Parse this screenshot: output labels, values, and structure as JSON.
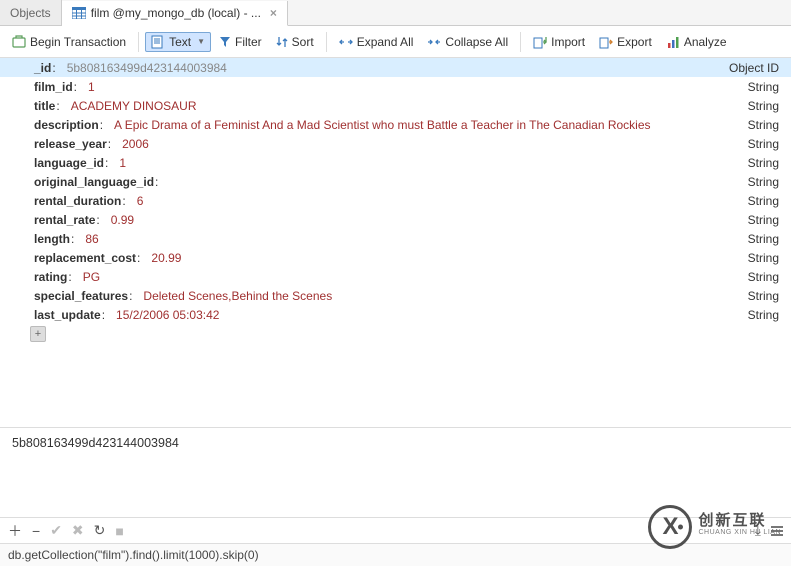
{
  "tabs": {
    "objects": "Objects",
    "active_label": "film @my_mongo_db (local) - ..."
  },
  "toolbar": {
    "begin_transaction": "Begin Transaction",
    "text": "Text",
    "filter": "Filter",
    "sort": "Sort",
    "expand_all": "Expand All",
    "collapse_all": "Collapse All",
    "import": "Import",
    "export": "Export",
    "analyze": "Analyze"
  },
  "types": {
    "objectid": "Object ID",
    "string": "String"
  },
  "doc": {
    "_id": {
      "k": "_id",
      "v": "5b808163499d423144003984"
    },
    "film_id": {
      "k": "film_id",
      "v": "1"
    },
    "title": {
      "k": "title",
      "v": "ACADEMY DINOSAUR"
    },
    "description": {
      "k": "description",
      "v": "A Epic Drama of a Feminist And a Mad Scientist who must Battle a Teacher in The Canadian Rockies"
    },
    "release_year": {
      "k": "release_year",
      "v": "2006"
    },
    "language_id": {
      "k": "language_id",
      "v": "1"
    },
    "original_language_id": {
      "k": "original_language_id",
      "v": ""
    },
    "rental_duration": {
      "k": "rental_duration",
      "v": "6"
    },
    "rental_rate": {
      "k": "rental_rate",
      "v": "0.99"
    },
    "length": {
      "k": "length",
      "v": "86"
    },
    "replacement_cost": {
      "k": "replacement_cost",
      "v": "20.99"
    },
    "rating": {
      "k": "rating",
      "v": "PG"
    },
    "special_features": {
      "k": "special_features",
      "v": "Deleted Scenes,Behind the Scenes"
    },
    "last_update": {
      "k": "last_update",
      "v": "15/2/2006 05:03:42"
    }
  },
  "id_echo": "5b808163499d423144003984",
  "query": "db.getCollection(\"film\").find().limit(1000).skip(0)",
  "watermark": {
    "cn": "创新互联",
    "py": "CHUANG XIN HU LIAN"
  }
}
